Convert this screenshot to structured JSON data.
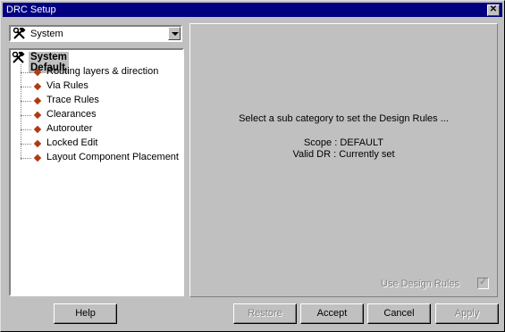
{
  "window": {
    "title": "DRC Setup",
    "close_glyph": "✕"
  },
  "combo": {
    "icon": "hammer-wrench-icon",
    "value": "System"
  },
  "tree": {
    "root": {
      "icon": "hammer-wrench-icon",
      "label": "System Default"
    },
    "items": [
      {
        "label": "Routing layers & direction"
      },
      {
        "label": "Via Rules"
      },
      {
        "label": "Trace Rules"
      },
      {
        "label": "Clearances"
      },
      {
        "label": "Autorouter"
      },
      {
        "label": "Locked Edit"
      },
      {
        "label": "Layout Component Placement"
      }
    ]
  },
  "panel": {
    "prompt": "Select a sub category to set the Design Rules ...",
    "scope": "Scope : DEFAULT",
    "valid": "Valid DR : Currently set",
    "use_design_rules_label": "Use Design Rules",
    "use_design_rules_checked": true
  },
  "buttons": {
    "help": "Help",
    "restore": "Restore",
    "accept": "Accept",
    "cancel": "Cancel",
    "apply": "Apply"
  },
  "colors": {
    "titlebar": "#000080",
    "diamond": "#b03a12",
    "face": "#c0c0c0"
  }
}
